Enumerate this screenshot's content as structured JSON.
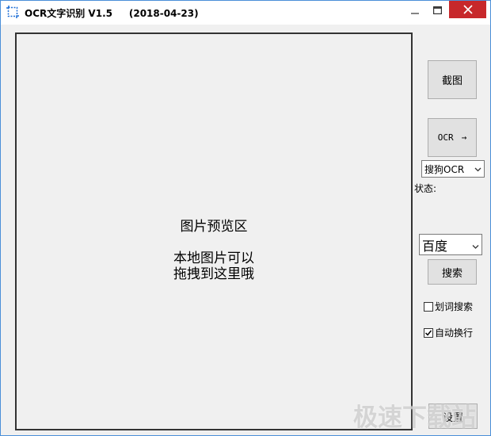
{
  "titlebar": {
    "title": "OCR文字识别 V1.5     (2018-04-23)",
    "minimize_icon": "minimize-icon",
    "maximize_icon": "maximize-icon",
    "close_icon": "close-icon"
  },
  "preview": {
    "title": "图片预览区",
    "hint_line1": "本地图片可以",
    "hint_line2": "拖拽到这里哦"
  },
  "sidebar": {
    "screenshot_label": "截图",
    "ocr_label": "OCR",
    "ocr_arrow": "→",
    "engine_selected": "搜狗OCR",
    "status_label": "状态:",
    "translate_selected": "百度",
    "search_label": "搜索",
    "word_search_label": "划词搜索",
    "auto_wrap_label": "自动换行",
    "word_search_checked": false,
    "auto_wrap_checked": true,
    "settings_label": "设置"
  },
  "watermark": {
    "text": "极速下载站"
  },
  "colors": {
    "close_button": "#c7282b",
    "window_border": "#4a8fd8",
    "background": "#f0f0f0"
  }
}
